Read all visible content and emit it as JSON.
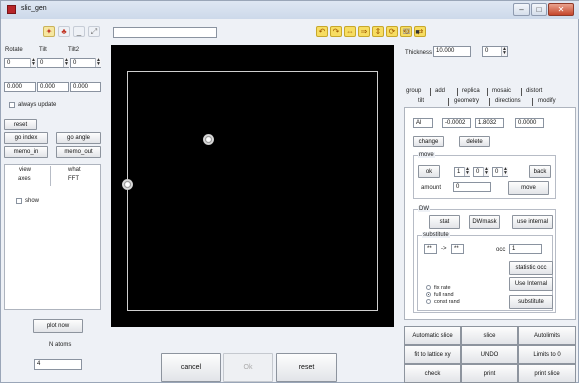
{
  "window": {
    "title": "slic_gen",
    "minimize": "–",
    "maximize": "□",
    "close": "✕"
  },
  "toolbar": {
    "left_buttons": [
      {
        "icon": "atom-add-icon",
        "glyph": "✦",
        "color": "#c23a2a"
      },
      {
        "icon": "figure-icon",
        "glyph": "♣",
        "color": "#c23a2a"
      },
      {
        "icon": "minus-icon",
        "glyph": "_",
        "color": "#555"
      },
      {
        "icon": "expand-icon",
        "glyph": "⤢",
        "color": "#777"
      }
    ],
    "text_value": "",
    "rotate_buttons": [
      {
        "icon": "rotate-left-icon",
        "glyph": "↶",
        "color": "#a05a00"
      },
      {
        "icon": "rotate-right-icon",
        "glyph": "↷",
        "color": "#a05a00"
      },
      {
        "icon": "flip-h-icon",
        "glyph": "⇔",
        "color": "#a05a00"
      },
      {
        "icon": "shift-icon",
        "glyph": "⇒",
        "color": "#a05a00"
      },
      {
        "icon": "flip-v-icon",
        "glyph": "⇕",
        "color": "#a05a00"
      },
      {
        "icon": "rotate-cw-icon",
        "glyph": "⟳",
        "color": "#a05a00"
      },
      {
        "icon": "rotate-ccw-icon",
        "glyph": "⟲",
        "color": "#a05a00"
      },
      {
        "icon": "mirror-icon",
        "glyph": "⇄",
        "color": "#a05a00"
      }
    ],
    "right_buttons": [
      {
        "icon": "open-icon",
        "glyph": "⌧",
        "color": "#999"
      },
      {
        "icon": "save-icon",
        "glyph": "■",
        "color": "#333"
      }
    ]
  },
  "left": {
    "rotate_label": "Rotate",
    "tilt_label": "Tilt",
    "tilt2_label": "Tilt2",
    "spin_values": [
      "0",
      "0",
      "0"
    ],
    "angle_values": [
      "0.000",
      "0.000",
      "0.000"
    ],
    "always_update": "always update",
    "reset": "reset",
    "go_index": "go index",
    "go_angle": "go angle",
    "memo_in": "memo_in",
    "memo_out": "memo_out",
    "tab_view": "view",
    "tab_what": "what",
    "tab_axes": "axes",
    "tab_fft": "FFT",
    "show": "show",
    "plot_now": "plot now",
    "n_atoms_label": "N atoms",
    "n_atoms_value": "4"
  },
  "bottom": {
    "cancel": "cancel",
    "ok": "Ok",
    "reset": "reset"
  },
  "right": {
    "thickness_label": "Thickness",
    "thickness_value": "10.000",
    "thickness_spin": "0",
    "tabs_row1": [
      "group",
      "add",
      "replica",
      "mosaic",
      "distort"
    ],
    "tabs_row2": [
      "tilt",
      "geometry",
      "directions",
      "modify"
    ],
    "element": "Al",
    "coords": [
      "-0.0002",
      "1.8032",
      "0.0000"
    ],
    "change": "change",
    "delete": "delete",
    "move_title": "move",
    "ok_button": "ok",
    "move_spins": [
      "1",
      "0",
      "0"
    ],
    "back": "back",
    "amount_label": "amount",
    "amount_value": "0",
    "move": "move",
    "dw_title": "DW",
    "stat": "stat",
    "dwmask": "DWmask",
    "use_internal": "use internal",
    "substitute_title": "substitute",
    "sub_from": "**",
    "sub_arrow": "->",
    "sub_to": "**",
    "occ_label": "occ",
    "occ_value": "1",
    "statistic_occ": "statistic occ",
    "use_internal2": "Use Internal",
    "substitute": "substitute",
    "radios": [
      "fix rate",
      "full rand",
      "const rand"
    ],
    "grid": [
      [
        "Automatic slice",
        "slice",
        "Autolimits"
      ],
      [
        "fit to lattice xy",
        "UNDO",
        "Limits to 0"
      ],
      [
        "check",
        "print",
        "print slice"
      ]
    ]
  }
}
